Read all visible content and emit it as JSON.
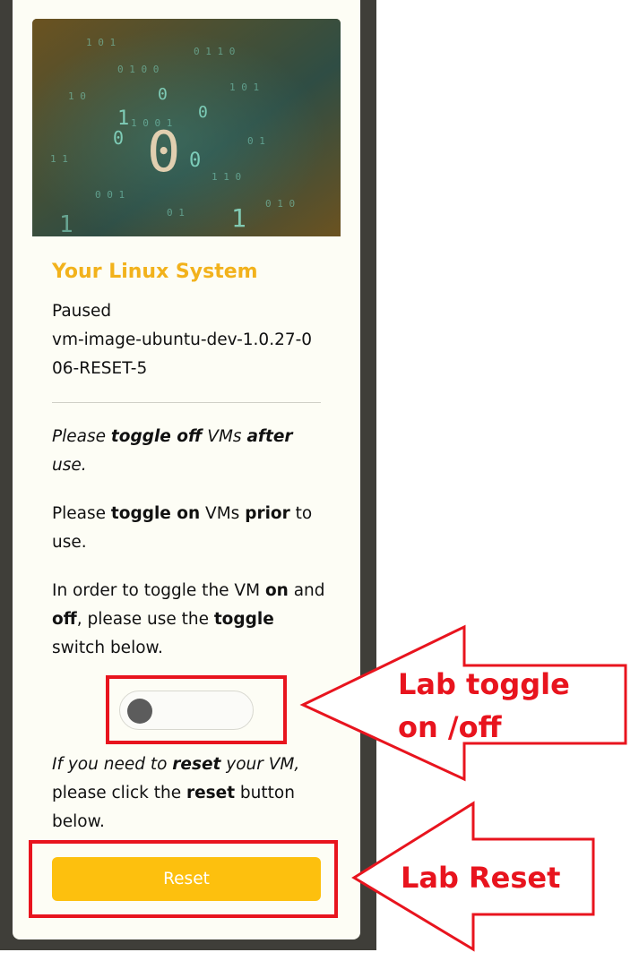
{
  "card": {
    "title": "Your Linux System",
    "status": "Paused",
    "image_name": "vm-image-ubuntu-dev-1.0.27-006-RESET-5",
    "para1": {
      "pre": "Please ",
      "b1": "toggle off",
      "mid": " VMs ",
      "b2": "after",
      "post": " use."
    },
    "para2": {
      "pre": "Please ",
      "b1": "toggle on",
      "mid": " VMs ",
      "b2": "prior",
      "post": " to use."
    },
    "para3": {
      "pre": "In order to toggle the VM ",
      "b1": "on",
      "mid1": " and ",
      "b2": "off",
      "mid2": ", please use the ",
      "b3": "toggle",
      "post": " switch below."
    },
    "para4": {
      "pre": "If you need to ",
      "b1": "reset",
      "mid": " your VM,",
      "mid2": " please click the ",
      "b2": "reset",
      "post": " button below."
    },
    "toggle_state": "off",
    "reset_label": "Reset"
  },
  "annotations": {
    "toggle_label": "Lab toggle\non /off",
    "reset_label": "Lab Reset"
  },
  "colors": {
    "accent_title": "#f2b21c",
    "reset_button": "#fdc00e",
    "annotation_red": "#e8141e",
    "backdrop": "#3f3e39"
  }
}
